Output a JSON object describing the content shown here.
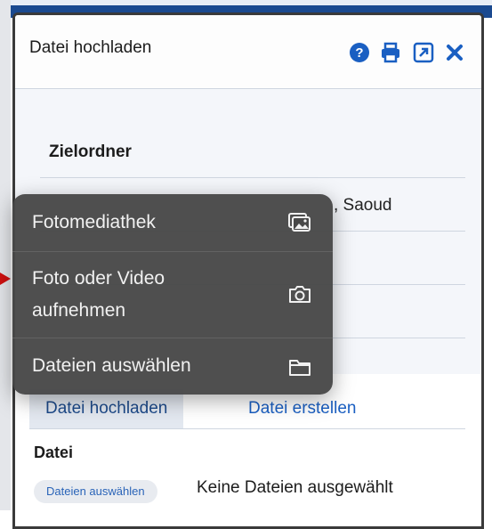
{
  "dialog": {
    "title": "Datei hochladen",
    "header_icons": [
      "help-icon",
      "print-icon",
      "popout-icon",
      "close-icon"
    ],
    "accent_color": "#1a5fc2"
  },
  "form": {
    "zielordner_label": "Zielordner",
    "zielordner_value_partial": ", Saoud"
  },
  "tabs": [
    {
      "label": "Datei hochladen",
      "active": true
    },
    {
      "label": "Datei erstellen",
      "active": false
    }
  ],
  "upload": {
    "datei_label": "Datei",
    "button_label": "Dateien auswählen",
    "status_text": "Keine Dateien ausgewählt"
  },
  "context_menu": {
    "items": [
      {
        "label": "Fotomediathek",
        "icon": "photo-library-icon"
      },
      {
        "label": "Foto oder Video aufnehmen",
        "icon": "camera-icon"
      },
      {
        "label": "Dateien auswählen",
        "icon": "folder-icon"
      }
    ]
  }
}
